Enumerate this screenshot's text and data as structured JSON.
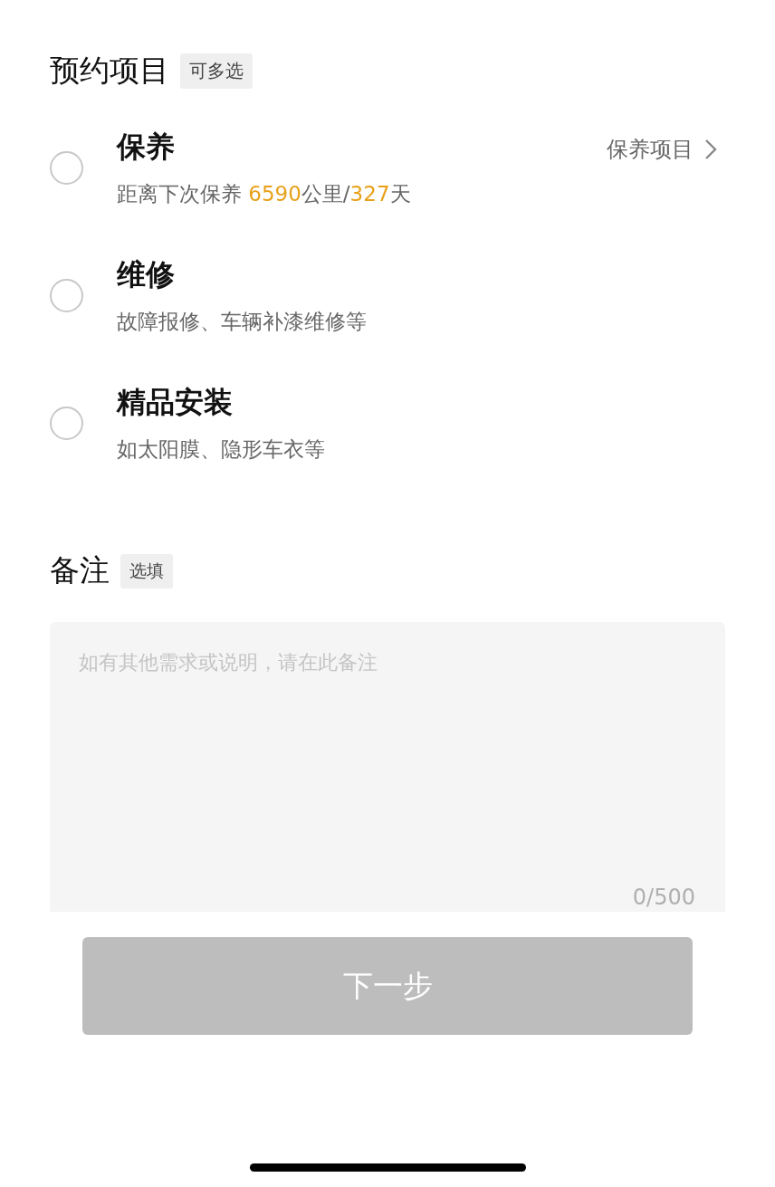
{
  "section": {
    "title": "预约项目",
    "tag": "可多选"
  },
  "items": [
    {
      "title": "保养",
      "selected": false,
      "subtitle": [
        {
          "text": "距离下次保养 ",
          "highlight": false
        },
        {
          "text": "6590",
          "highlight": true
        },
        {
          "text": "公里/",
          "highlight": false
        },
        {
          "text": "327",
          "highlight": true
        },
        {
          "text": "天",
          "highlight": false
        }
      ],
      "link": "保养项目"
    },
    {
      "title": "维修",
      "selected": false,
      "subtitle": [
        {
          "text": "故障报修、车辆补漆维修等",
          "highlight": false
        }
      ]
    },
    {
      "title": "精品安装",
      "selected": false,
      "subtitle": [
        {
          "text": "如太阳膜、隐形车衣等",
          "highlight": false
        }
      ]
    }
  ],
  "remarks": {
    "title": "备注",
    "tag": "选填",
    "placeholder": "如有其他需求或说明，请在此备注",
    "counter": "0/500"
  },
  "next_button": {
    "label": "下一步",
    "disabled": true
  }
}
